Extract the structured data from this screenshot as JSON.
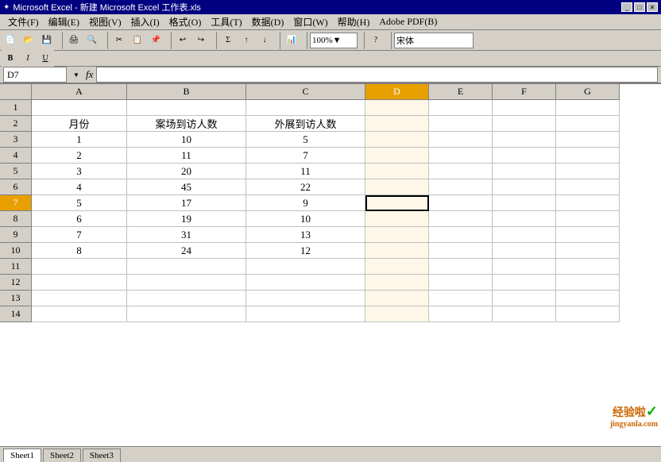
{
  "titleBar": {
    "icon": "✦",
    "title": "Microsoft Excel - 新建 Microsoft Excel 工作表.xls",
    "buttons": [
      "_",
      "□",
      "✕"
    ]
  },
  "menuBar": {
    "items": [
      "文件(F)",
      "编辑(E)",
      "视图(V)",
      "插入(I)",
      "格式(O)",
      "工具(T)",
      "数据(D)",
      "窗口(W)",
      "帮助(H)",
      "Adobe PDF(B)"
    ]
  },
  "toolbar": {
    "font": "宋体",
    "zoom": "100%"
  },
  "formulaBar": {
    "cellRef": "D7",
    "fx": "fx"
  },
  "columns": [
    "A",
    "B",
    "C",
    "D",
    "E",
    "F",
    "G"
  ],
  "selectedCol": "D",
  "activeCell": {
    "row": 7,
    "col": "D"
  },
  "rows": [
    {
      "num": 1,
      "cells": [
        "",
        "",
        "",
        "",
        "",
        "",
        ""
      ]
    },
    {
      "num": 2,
      "cells": [
        "月份",
        "案场到访人数",
        "外展到访人数",
        "",
        "",
        "",
        ""
      ]
    },
    {
      "num": 3,
      "cells": [
        "1",
        "10",
        "5",
        "",
        "",
        "",
        ""
      ]
    },
    {
      "num": 4,
      "cells": [
        "2",
        "11",
        "7",
        "",
        "",
        "",
        ""
      ]
    },
    {
      "num": 5,
      "cells": [
        "3",
        "20",
        "11",
        "",
        "",
        "",
        ""
      ]
    },
    {
      "num": 6,
      "cells": [
        "4",
        "45",
        "22",
        "",
        "",
        "",
        ""
      ]
    },
    {
      "num": 7,
      "cells": [
        "5",
        "17",
        "9",
        "",
        "",
        "",
        ""
      ]
    },
    {
      "num": 8,
      "cells": [
        "6",
        "19",
        "10",
        "",
        "",
        "",
        ""
      ]
    },
    {
      "num": 9,
      "cells": [
        "7",
        "31",
        "13",
        "",
        "",
        "",
        ""
      ]
    },
    {
      "num": 10,
      "cells": [
        "8",
        "24",
        "12",
        "",
        "",
        "",
        ""
      ]
    },
    {
      "num": 11,
      "cells": [
        "",
        "",
        "",
        "",
        "",
        "",
        ""
      ]
    },
    {
      "num": 12,
      "cells": [
        "",
        "",
        "",
        "",
        "",
        "",
        ""
      ]
    },
    {
      "num": 13,
      "cells": [
        "",
        "",
        "",
        "",
        "",
        "",
        ""
      ]
    },
    {
      "num": 14,
      "cells": [
        "",
        "",
        "",
        "",
        "",
        "",
        ""
      ]
    }
  ],
  "sheetTabs": [
    "Sheet1",
    "Sheet2",
    "Sheet3"
  ],
  "activeSheet": "Sheet1",
  "watermark": {
    "text": "经验啦✓",
    "sub": "jingyanla.com"
  }
}
